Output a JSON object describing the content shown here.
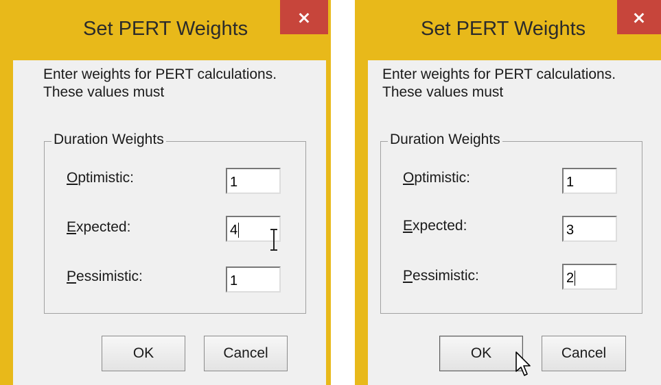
{
  "dialogs": [
    {
      "title": "Set PERT Weights",
      "close_label": "×",
      "intro": "Enter weights for PERT calculations. These values must",
      "group_title": "Duration Weights",
      "optimistic": {
        "label_first": "O",
        "label_rest": "ptimistic:",
        "value": "1"
      },
      "expected": {
        "label_first": "E",
        "label_rest": "xpected:",
        "value": "4"
      },
      "pessimistic": {
        "label_first": "P",
        "label_rest": "essimistic:",
        "value": "1"
      },
      "ok_label": "OK",
      "cancel_label": "Cancel"
    },
    {
      "title": "Set PERT Weights",
      "close_label": "×",
      "intro": "Enter weights for PERT calculations. These values must",
      "group_title": "Duration Weights",
      "optimistic": {
        "label_first": "O",
        "label_rest": "ptimistic:",
        "value": "1"
      },
      "expected": {
        "label_first": "E",
        "label_rest": "xpected:",
        "value": "3"
      },
      "pessimistic": {
        "label_first": "P",
        "label_rest": "essimistic:",
        "value": "2"
      },
      "ok_label": "OK",
      "cancel_label": "Cancel"
    }
  ],
  "colors": {
    "title_bar": "#e8b91a",
    "close_button": "#c7453b",
    "client": "#f0f0f0"
  },
  "icons": [
    "close-icon",
    "text-cursor-icon",
    "mouse-pointer-icon"
  ]
}
